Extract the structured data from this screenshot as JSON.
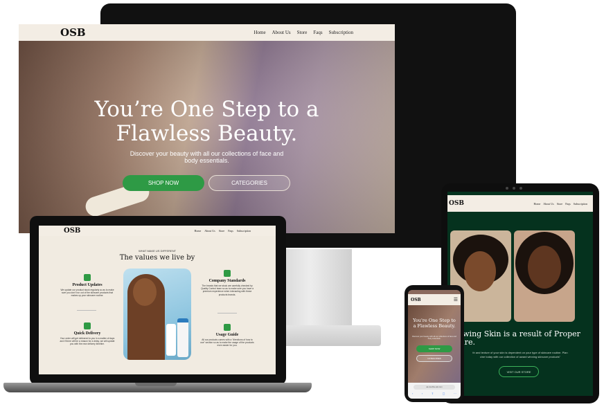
{
  "desktop": {
    "logo": "OSB",
    "nav": [
      "Home",
      "About Us",
      "Store",
      "Faqs",
      "Subscription"
    ],
    "hero_title_line1": "You’re One Step to a",
    "hero_title_line2": "Flawless Beauty.",
    "hero_sub_line1": "Discover your beauty with all our collections of face and",
    "hero_sub_line2": "body essentials.",
    "shop_button": "SHOP NOW",
    "categories_button": "CATEGORIES",
    "colors": {
      "nav_bg": "#f3ede4",
      "shop_button": "#2e9a45"
    }
  },
  "laptop": {
    "logo": "OSB",
    "nav": [
      "Home",
      "About Us",
      "Store",
      "Faqs",
      "Subscription"
    ],
    "kicker": "WHAT MAKE US DIFFERENT",
    "title": "The values we live by",
    "features": [
      {
        "icon": "leaf-icon",
        "title": "Product Updates",
        "text": "We update our product stock regularly so as to make sure you don't run out of the skincare products that makes up your skincare routine."
      },
      {
        "icon": "delivery-box-icon",
        "title": "Quick Delivery",
        "text": "Your order will get delivered to you in a matter of days and if there will be a reason for a delay, we will update you with the new delivery timeline."
      },
      {
        "icon": "badge-check-icon",
        "title": "Company Standards",
        "text": "The brands that we stock are carefully checked by Quality Control team so as to make sure you have a premium experience when interacting with these products brands."
      },
      {
        "icon": "guide-badge-icon",
        "title": "Usage Guide",
        "text": "All our products comes with a \"directions of how to use\" section so as to make the usage of the products even easier for you."
      }
    ]
  },
  "tablet": {
    "logo": "OSB",
    "nav": [
      "Home",
      "About Us",
      "Store",
      "Faqs",
      "Subscription"
    ],
    "heading_line1": "lowing Skin is a result of Proper",
    "heading_line2": "care.",
    "text_line1": "th and texture of your skin is dependent on your type of skincare routine. Plan",
    "text_line2": "cine today with our collection of award winning skincare products\"",
    "button": "VISIT OUR STORE"
  },
  "phone": {
    "logo": "OSB",
    "hero_title_line1": "You're One Step to",
    "hero_title_line2": "a Flawless Beauty.",
    "hero_sub": "Discover your beauty with all our collections of face and body essentials.",
    "shop_button": "SHOP NOW",
    "categories_button": "CATEGORIES",
    "url": "ak.com/the-osb.com",
    "toolbar": [
      "‹",
      "›",
      "⇪",
      "▢",
      "⋯"
    ]
  }
}
